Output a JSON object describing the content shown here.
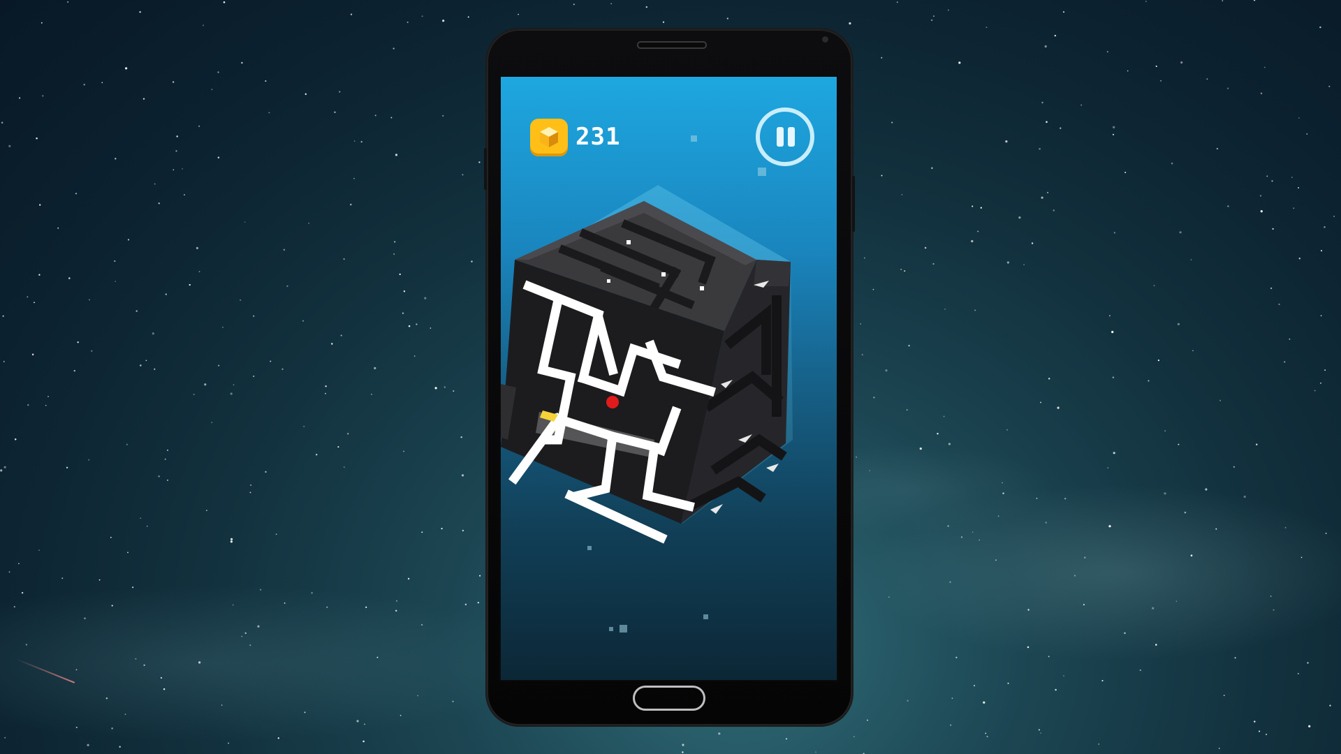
{
  "hud": {
    "coins": "231",
    "coin_icon": "cube-coin-icon",
    "pause_icon": "pause-icon"
  },
  "colors": {
    "sky_top": "#1ea7e0",
    "sky_bottom": "#0c2736",
    "coin": "#ffbf16",
    "ball": "#e11b1b",
    "goal": "#f6d23a",
    "maze_block": "#2a2a2c",
    "maze_path": "#ffffff"
  }
}
